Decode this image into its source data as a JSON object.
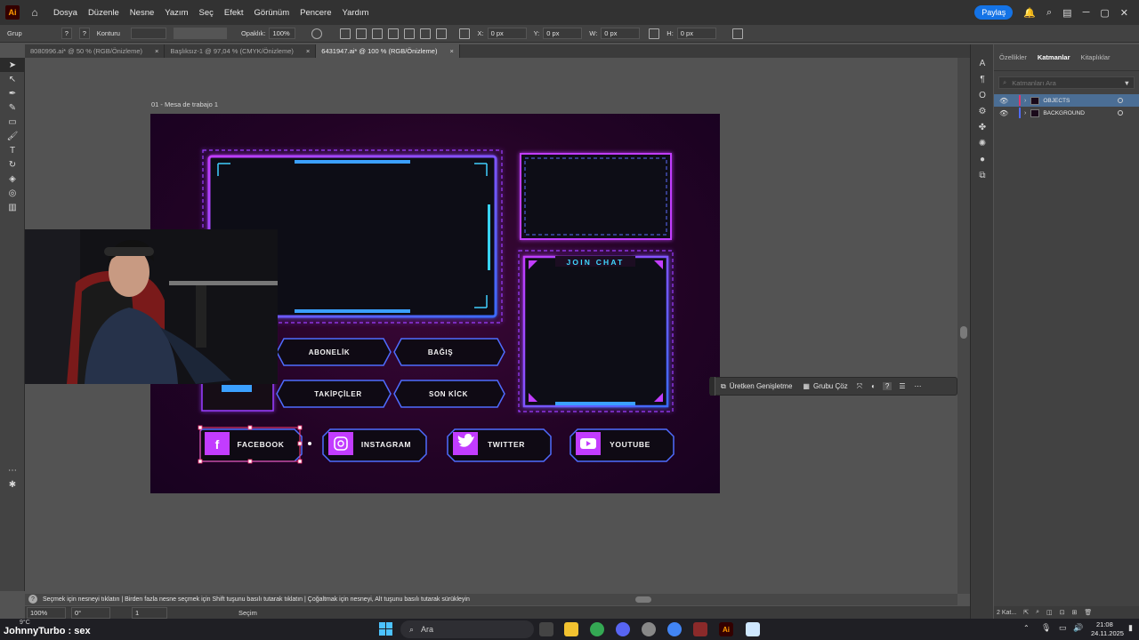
{
  "app": {
    "logo_text": "Ai",
    "menus": [
      "Dosya",
      "Düzenle",
      "Nesne",
      "Yazım",
      "Seç",
      "Efekt",
      "Görünüm",
      "Pencere",
      "Yardım"
    ],
    "share_label": "Paylaş"
  },
  "control_bar": {
    "selection_type": "Grup",
    "stroke_label": "Konturu",
    "opacity_label": "Opaklık:",
    "opacity_value": "100%",
    "x_label": "X:",
    "x_value": "0 px",
    "y_label": "Y:",
    "y_value": "0 px",
    "w_label": "W:",
    "w_value": "0 px",
    "h_label": "H:",
    "h_value": "0 px"
  },
  "tabs": [
    {
      "label": "8080996.ai* @ 50 % (RGB/Önizleme)",
      "active": false
    },
    {
      "label": "Başlıksız-1 @ 97,04 % (CMYK/Önizleme)",
      "active": false
    },
    {
      "label": "6431947.ai* @ 100 % (RGB/Önizleme)",
      "active": true
    }
  ],
  "tab_close": "×",
  "artboard": {
    "label": "01 - Mesa de trabajo 1",
    "join_chat": "JOIN CHAT",
    "buttons": [
      "ABONELİK",
      "BAĞIŞ",
      "TAKİPÇİLER",
      "SON KİCK"
    ],
    "socials": [
      "FACEBOOK",
      "INSTAGRAM",
      "TWITTER",
      "YOUTUBE"
    ]
  },
  "context_bar": {
    "generative_expand": "Üretken Genişletme",
    "ungroup": "Grubu Çöz",
    "help": "?"
  },
  "status_hint": "Seçmek için nesneyi tıklatın  |  Birden fazla nesne seçmek için Shift tuşunu basılı tutarak tıklatın  |  Çoğaltmak için nesneyi, Alt tuşunu basılı tutarak sürükleyin",
  "bottom_bar": {
    "zoom": "100%",
    "rotation": "0°",
    "artboard_index": "1",
    "mode": "Seçim"
  },
  "layers_panel": {
    "tabs": [
      "Özellikler",
      "Katmanlar",
      "Kitaplıklar"
    ],
    "search_placeholder": "Katmanları Ara",
    "layers": [
      {
        "name": "OBJECTS",
        "color": "#e0386a",
        "selected": true
      },
      {
        "name": "BACKGROUND",
        "color": "#4f6cff",
        "selected": false
      }
    ],
    "footer": "2 Kat..."
  },
  "taskbar": {
    "weather": "9°C",
    "stream_overlay": "JohnnyTurbo : sex",
    "search_label": "Ara",
    "time": "21:08",
    "date": "24.11.2025"
  },
  "colors": {
    "accent": "#1473e6",
    "neon_pink": "#d23bff",
    "neon_blue": "#3aa0ff",
    "neon_cyan": "#39d3ff",
    "facebook_selection": "#ff3b7a"
  },
  "icons": [
    "home-icon",
    "notifications-icon",
    "search-icon",
    "arrange-icon",
    "minimize-icon",
    "maximize-icon",
    "close-icon",
    "filter-icon",
    "eye-icon",
    "grip-icon",
    "more-icon",
    "windows-icon"
  ]
}
